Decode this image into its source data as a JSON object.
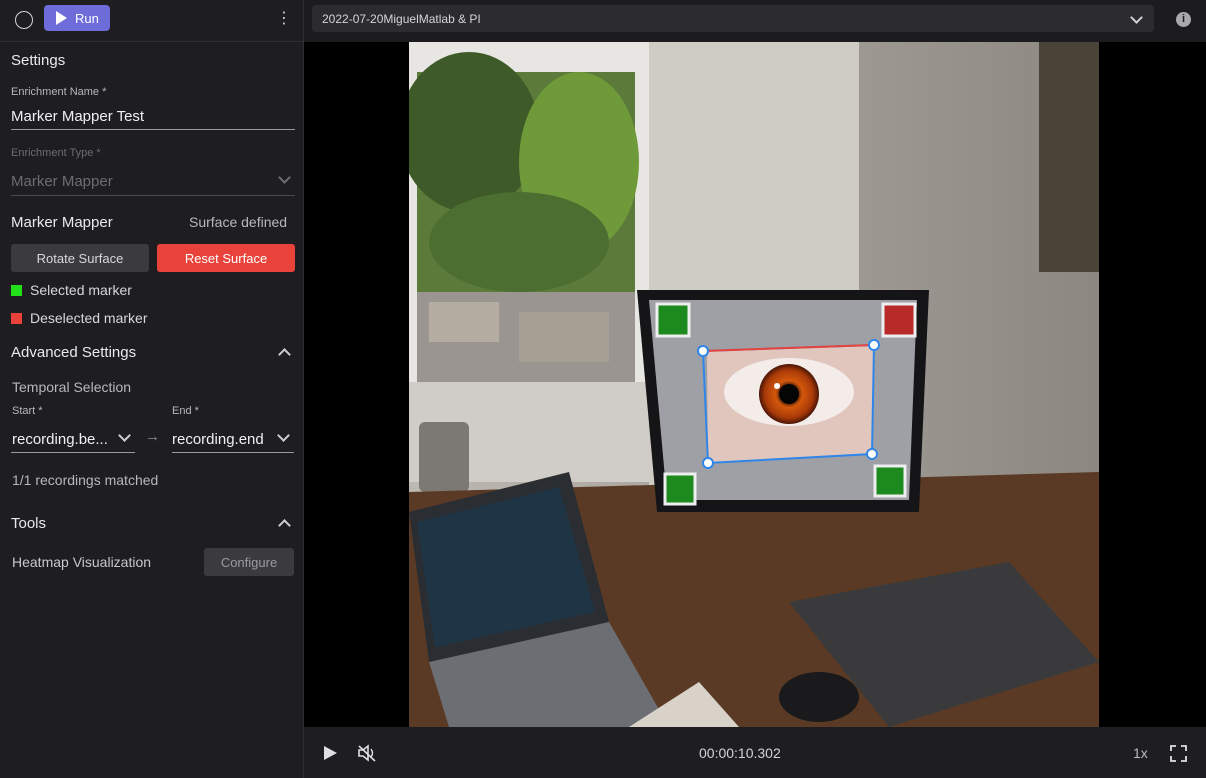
{
  "toolbar": {
    "run_label": "Run",
    "more_icon": "kebab-icon"
  },
  "recording": {
    "selected": "2022-07-20MiguelMatlab & PI"
  },
  "settings": {
    "heading": "Settings",
    "enrichment_name_label": "Enrichment Name *",
    "enrichment_name_value": "Marker Mapper Test",
    "enrichment_type_label": "Enrichment Type *",
    "enrichment_type_value": "Marker Mapper"
  },
  "marker_mapper": {
    "title": "Marker Mapper",
    "status": "Surface defined",
    "rotate_label": "Rotate Surface",
    "reset_label": "Reset Surface",
    "selected_marker": "Selected marker",
    "deselected_marker": "Deselected marker",
    "selected_color": "#22e01a",
    "deselected_color": "#e8423a"
  },
  "advanced": {
    "title": "Advanced Settings",
    "temporal_selection": "Temporal Selection",
    "start_label": "Start *",
    "start_value": "recording.be...",
    "end_label": "End *",
    "end_value": "recording.end",
    "matched": "1/1 recordings matched"
  },
  "tools": {
    "title": "Tools",
    "heatmap_label": "Heatmap Visualization",
    "configure_label": "Configure"
  },
  "player": {
    "time": "00:00:10.302",
    "speed": "1x"
  },
  "colors": {
    "accent": "#6e6cd9",
    "danger": "#e8423a",
    "surface_outline": "#2f86e8"
  }
}
